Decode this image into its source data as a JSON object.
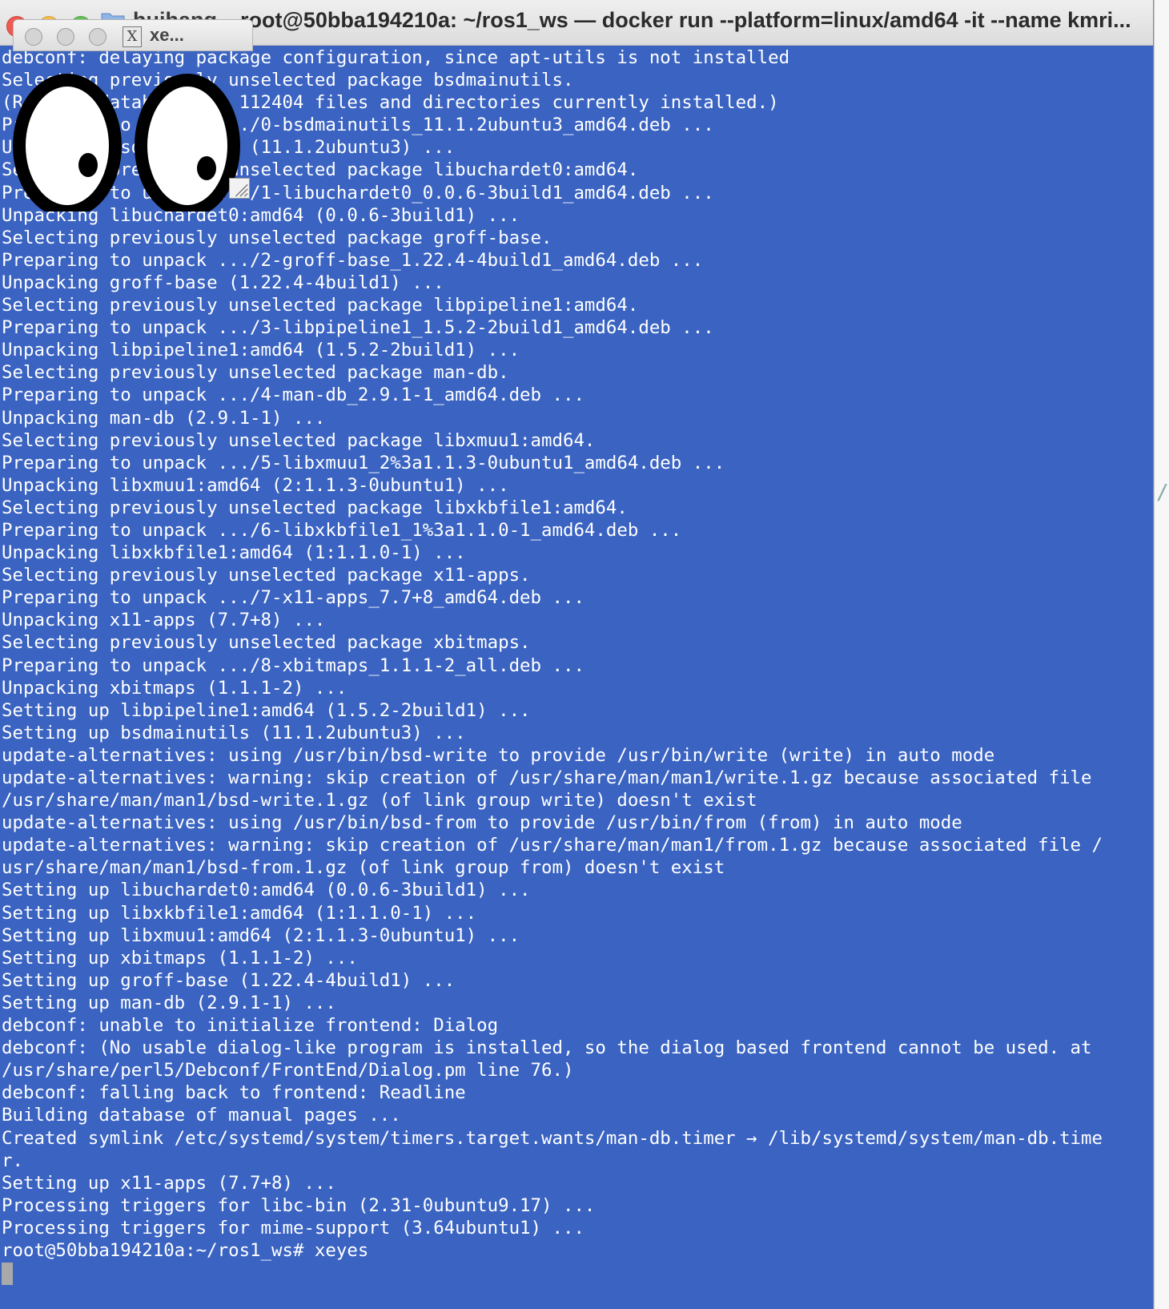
{
  "window": {
    "folder_label": "huihang",
    "title": "root@50bba194210a: ~/ros1_ws — docker run --platform=linux/amd64 -it --name kmri..."
  },
  "xeyes": {
    "title": "xe...",
    "x_glyph": "X"
  },
  "terminal": {
    "lines": [
      "debconf: delaying package configuration, since apt-utils is not installed",
      "Selecting previously unselected package bsdmainutils.",
      "(Reading database ... 112404 files and directories currently installed.)",
      "Preparing to unpack .../0-bsdmainutils_11.1.2ubuntu3_amd64.deb ...",
      "Unpacking bsdmainutils (11.1.2ubuntu3) ...",
      "Selecting previously unselected package libuchardet0:amd64.",
      "Preparing to unpack .../1-libuchardet0_0.0.6-3build1_amd64.deb ...",
      "Unpacking libuchardet0:amd64 (0.0.6-3build1) ...",
      "Selecting previously unselected package groff-base.",
      "Preparing to unpack .../2-groff-base_1.22.4-4build1_amd64.deb ...",
      "Unpacking groff-base (1.22.4-4build1) ...",
      "Selecting previously unselected package libpipeline1:amd64.",
      "Preparing to unpack .../3-libpipeline1_1.5.2-2build1_amd64.deb ...",
      "Unpacking libpipeline1:amd64 (1.5.2-2build1) ...",
      "Selecting previously unselected package man-db.",
      "Preparing to unpack .../4-man-db_2.9.1-1_amd64.deb ...",
      "Unpacking man-db (2.9.1-1) ...",
      "Selecting previously unselected package libxmuu1:amd64.",
      "Preparing to unpack .../5-libxmuu1_2%3a1.1.3-0ubuntu1_amd64.deb ...",
      "Unpacking libxmuu1:amd64 (2:1.1.3-0ubuntu1) ...",
      "Selecting previously unselected package libxkbfile1:amd64.",
      "Preparing to unpack .../6-libxkbfile1_1%3a1.1.0-1_amd64.deb ...",
      "Unpacking libxkbfile1:amd64 (1:1.1.0-1) ...",
      "Selecting previously unselected package x11-apps.",
      "Preparing to unpack .../7-x11-apps_7.7+8_amd64.deb ...",
      "Unpacking x11-apps (7.7+8) ...",
      "Selecting previously unselected package xbitmaps.",
      "Preparing to unpack .../8-xbitmaps_1.1.1-2_all.deb ...",
      "Unpacking xbitmaps (1.1.1-2) ...",
      "Setting up libpipeline1:amd64 (1.5.2-2build1) ...",
      "Setting up bsdmainutils (11.1.2ubuntu3) ...",
      "update-alternatives: using /usr/bin/bsd-write to provide /usr/bin/write (write) in auto mode",
      "update-alternatives: warning: skip creation of /usr/share/man/man1/write.1.gz because associated file",
      "/usr/share/man/man1/bsd-write.1.gz (of link group write) doesn't exist",
      "update-alternatives: using /usr/bin/bsd-from to provide /usr/bin/from (from) in auto mode",
      "update-alternatives: warning: skip creation of /usr/share/man/man1/from.1.gz because associated file /",
      "usr/share/man/man1/bsd-from.1.gz (of link group from) doesn't exist",
      "Setting up libuchardet0:amd64 (0.0.6-3build1) ...",
      "Setting up libxkbfile1:amd64 (1:1.1.0-1) ...",
      "Setting up libxmuu1:amd64 (2:1.1.3-0ubuntu1) ...",
      "Setting up xbitmaps (1.1.1-2) ...",
      "Setting up groff-base (1.22.4-4build1) ...",
      "Setting up man-db (2.9.1-1) ...",
      "debconf: unable to initialize frontend: Dialog",
      "debconf: (No usable dialog-like program is installed, so the dialog based frontend cannot be used. at",
      "/usr/share/perl5/Debconf/FrontEnd/Dialog.pm line 76.)",
      "debconf: falling back to frontend: Readline",
      "Building database of manual pages ...",
      "Created symlink /etc/systemd/system/timers.target.wants/man-db.timer → /lib/systemd/system/man-db.time",
      "r.",
      "Setting up x11-apps (7.7+8) ...",
      "Processing triggers for libc-bin (2.31-0ubuntu9.17) ...",
      "Processing triggers for mime-support (3.64ubuntu1) ...",
      "root@50bba194210a:~/ros1_ws# xeyes"
    ]
  },
  "colors": {
    "terminal_bg": "#3a63c2",
    "terminal_fg": "#ffffff",
    "cursor": "#a9a9a9"
  },
  "icons": {
    "close": "close-icon",
    "minimize": "minimize-icon",
    "zoom": "zoom-icon",
    "folder": "folder-icon",
    "x11": "x11-logo-icon",
    "resize": "resize-grip-icon"
  }
}
